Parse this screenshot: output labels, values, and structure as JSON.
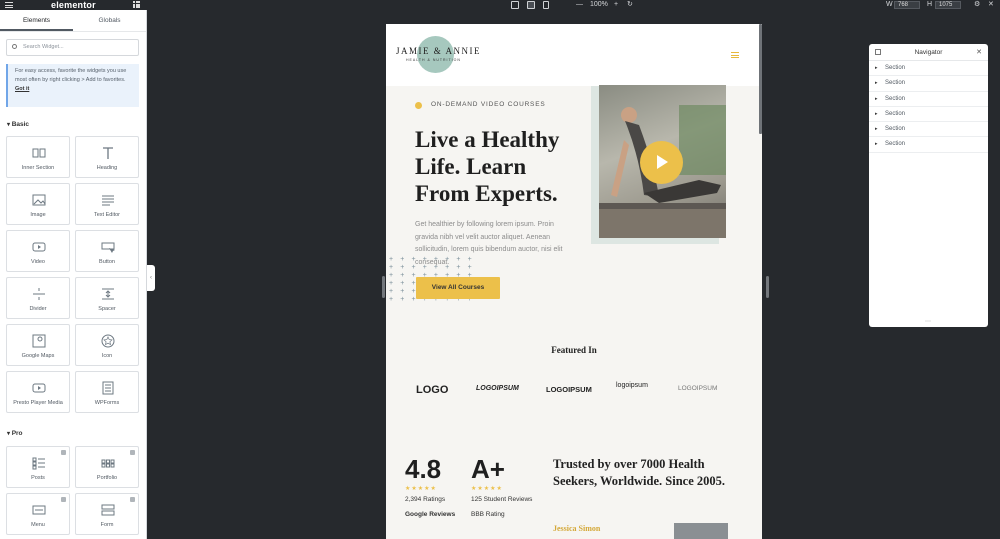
{
  "topbar": {
    "app_name": "elementor",
    "zoom": "100%",
    "width_label": "W",
    "width_value": "768",
    "height_label": "H",
    "height_value": "1075"
  },
  "panel": {
    "tabs": [
      "Elements",
      "Globals"
    ],
    "search_placeholder": "Search Widget...",
    "tip_text": "For easy access, favorite the widgets you use most often by right clicking > Add to favorites.",
    "tip_link": "Got it",
    "categories": {
      "basic": "Basic",
      "pro": "Pro"
    },
    "basic_widgets": [
      "Inner Section",
      "Heading",
      "Image",
      "Text Editor",
      "Video",
      "Button",
      "Divider",
      "Spacer",
      "Google Maps",
      "Icon",
      "Presto Player Media",
      "WPForms"
    ],
    "pro_widgets": [
      "Posts",
      "Portfolio",
      "Menu",
      "Form"
    ]
  },
  "site": {
    "brand": "JAMIE & ANNIE",
    "brand_sub": "HEALTH & NUTRITION",
    "eyebrow": "ON-DEMAND VIDEO COURSES",
    "headline": "Live a Healthy Life. Learn From Experts.",
    "body": "Get healthier by following lorem ipsum. Proin gravida nibh vel velit auctor aliquet. Aenean sollicitudin, lorem quis bibendum auctor, nisi elit consequat.",
    "cta": "View All Courses",
    "featured_title": "Featured In",
    "logos": [
      "LOGO",
      "LOGOIPSUM",
      "LOGOIPSUM",
      "logoipsum",
      "LOGOIPSUM"
    ],
    "stat1": {
      "value": "4.8",
      "stars": "★★★★★",
      "count": "2,394 Ratings",
      "source": "Google Reviews"
    },
    "stat2": {
      "value": "A+",
      "stars": "★★★★★",
      "count": "125 Student Reviews",
      "source": "BBB Rating"
    },
    "trusted": "Trusted by over 7000 Health Seekers, Worldwide. Since 2005.",
    "person": "Jessica Simon"
  },
  "navigator": {
    "title": "Navigator",
    "items": [
      "Section",
      "Section",
      "Section",
      "Section",
      "Section",
      "Section"
    ]
  },
  "colors": {
    "accent": "#ecc04a",
    "teal": "#a6c8be"
  }
}
